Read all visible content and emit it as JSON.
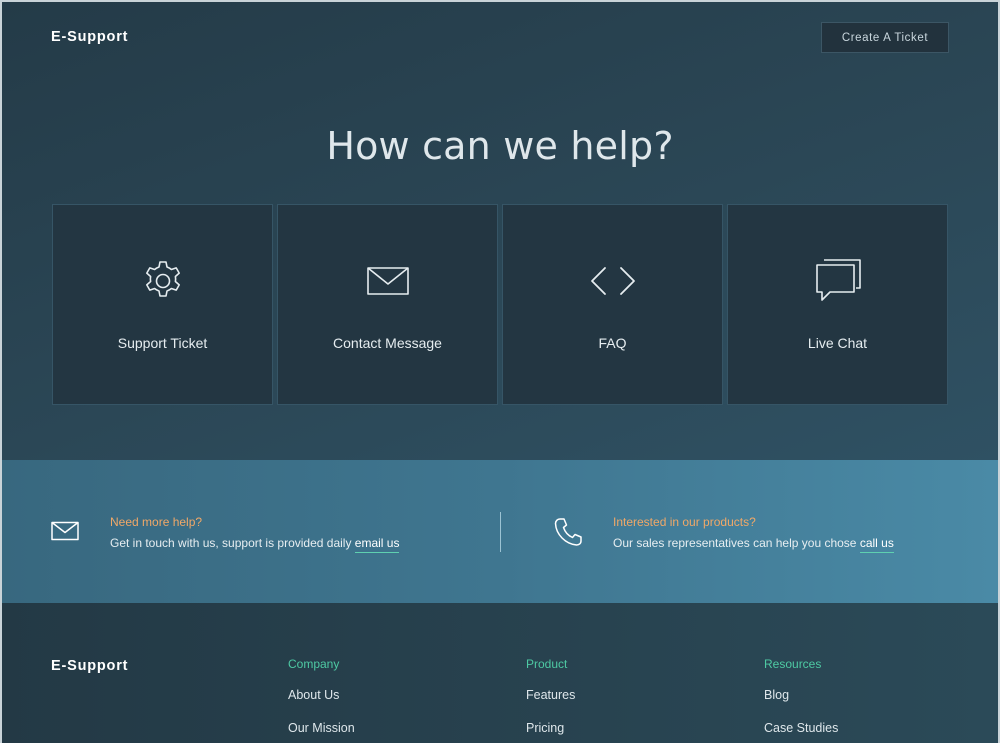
{
  "header": {
    "brand": "E-Support",
    "create_ticket_label": "Create A Ticket"
  },
  "hero": {
    "title": "How can we help?"
  },
  "cards": [
    {
      "label": "Support Ticket",
      "icon": "gear-icon"
    },
    {
      "label": "Contact Message",
      "icon": "envelope-icon"
    },
    {
      "label": "FAQ",
      "icon": "code-icon"
    },
    {
      "label": "Live Chat",
      "icon": "chat-bubbles-icon"
    }
  ],
  "help_band": {
    "left": {
      "icon": "envelope-icon",
      "title": "Need more help?",
      "text": "Get in touch with us, support is provided daily ",
      "link": "email us"
    },
    "right": {
      "icon": "phone-icon",
      "title": "Interested in our products?",
      "text": "Our sales representatives can help you chose ",
      "link": "call us"
    }
  },
  "footer": {
    "brand": "E-Support",
    "columns": [
      {
        "heading": "Company",
        "links": [
          "About Us",
          "Our Mission"
        ]
      },
      {
        "heading": "Product",
        "links": [
          "Features",
          "Pricing"
        ]
      },
      {
        "heading": "Resources",
        "links": [
          "Blog",
          "Case Studies"
        ]
      }
    ]
  },
  "colors": {
    "accent_orange": "#f0a868",
    "accent_green": "#4ec9a3",
    "hero_bg": "#2b4756",
    "band_bg": "#3f7690"
  }
}
